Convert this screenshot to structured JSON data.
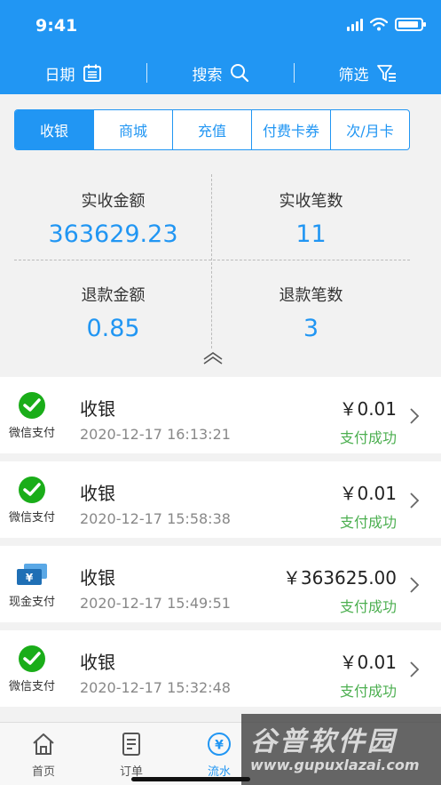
{
  "status": {
    "time": "9:41"
  },
  "toolbar": {
    "date_label": "日期",
    "search_label": "搜索",
    "filter_label": "筛选"
  },
  "tabs": [
    "收银",
    "商城",
    "充值",
    "付费卡券",
    "次/月卡"
  ],
  "summary": {
    "actual_amount_label": "实收金额",
    "actual_amount": "363629.23",
    "actual_count_label": "实收笔数",
    "actual_count": "11",
    "refund_amount_label": "退款金额",
    "refund_amount": "0.85",
    "refund_count_label": "退款笔数",
    "refund_count": "3"
  },
  "transactions": [
    {
      "method": "微信支付",
      "method_icon": "wechat-pay-icon",
      "title": "收银",
      "time": "2020-12-17 16:13:21",
      "amount": "￥0.01",
      "status": "支付成功"
    },
    {
      "method": "微信支付",
      "method_icon": "wechat-pay-icon",
      "title": "收银",
      "time": "2020-12-17 15:58:38",
      "amount": "￥0.01",
      "status": "支付成功"
    },
    {
      "method": "现金支付",
      "method_icon": "cash-pay-icon",
      "title": "收银",
      "time": "2020-12-17 15:49:51",
      "amount": "￥363625.00",
      "status": "支付成功"
    },
    {
      "method": "微信支付",
      "method_icon": "wechat-pay-icon",
      "title": "收银",
      "time": "2020-12-17 15:32:48",
      "amount": "￥0.01",
      "status": "支付成功"
    }
  ],
  "tabbar": {
    "home": "首页",
    "orders": "订单",
    "flow": "流水"
  },
  "watermark": {
    "logo": "谷普软件园",
    "url": "www.gupuxlazai.com"
  },
  "colors": {
    "primary": "#2196f3",
    "success": "#4caf50",
    "wechat": "#1aad19",
    "cash": "#1f6fb5"
  }
}
